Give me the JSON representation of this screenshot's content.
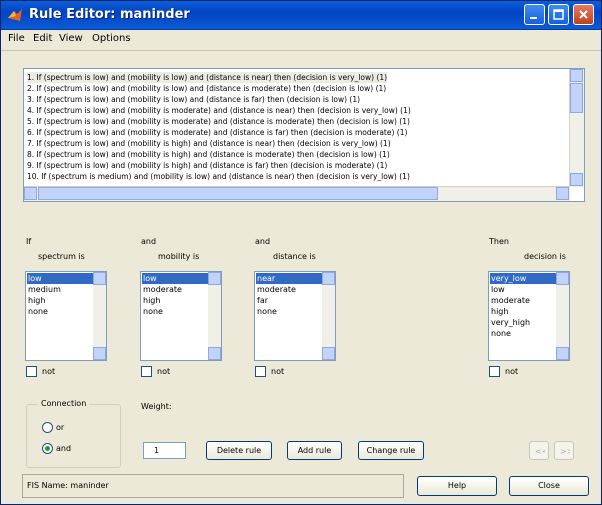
{
  "window": {
    "title": "Rule Editor: maninder"
  },
  "menu": [
    "File",
    "Edit",
    "View",
    "Options"
  ],
  "rules": [
    "1. If (spectrum is low) and (mobility is low) and (distance is near) then (decision is very_low) (1)",
    "2. If (spectrum is low) and (mobility is low) and (distance is moderate) then (decision is low) (1)",
    "3. If (spectrum is low) and (mobility is low) and (distance is far) then (decision is low) (1)",
    "4. If (spectrum is low) and (mobility is moderate) and (distance is near) then (decision is very_low) (1)",
    "5. If (spectrum is low) and (mobility is moderate) and (distance is moderate) then (decision is low) (1)",
    "6. If (spectrum is low) and (mobility is moderate) and (distance is far) then (decision is moderate) (1)",
    "7. If (spectrum is low) and (mobility is high) and (distance is near) then (decision is very_low) (1)",
    "8. If (spectrum is low) and (mobility is high) and (distance is moderate) then (decision is low) (1)",
    "9. If (spectrum is low) and (mobility is high) and (distance is far) then (decision is moderate) (1)",
    "10. If (spectrum is medium) and (mobility is low) and (distance is near) then (decision is very_low) (1)"
  ],
  "antecedents": [
    {
      "prefix": "If",
      "label": "spectrum is",
      "options": [
        "low",
        "medium",
        "high",
        "none"
      ],
      "not_label": "not"
    },
    {
      "prefix": "and",
      "label": "mobility is",
      "options": [
        "low",
        "moderate",
        "high",
        "none"
      ],
      "not_label": "not"
    },
    {
      "prefix": "and",
      "label": "distance is",
      "options": [
        "near",
        "moderate",
        "far",
        "none"
      ],
      "not_label": "not"
    }
  ],
  "consequent": {
    "prefix": "Then",
    "label": "decision is",
    "options": [
      "very_low",
      "low",
      "moderate",
      "high",
      "very_high",
      "none"
    ],
    "not_label": "not"
  },
  "connection": {
    "title": "Connection",
    "options": [
      "or",
      "and"
    ],
    "selected": "and"
  },
  "weight": {
    "label": "Weight:",
    "value": "1"
  },
  "buttons": {
    "delete": "Delete rule",
    "add": "Add rule",
    "change": "Change rule",
    "help": "Help",
    "close": "Close"
  },
  "status": {
    "fis_name": "FIS Name: maninder"
  },
  "colors": {
    "titlebar": "#0443c4",
    "selection": "#316ac5",
    "face": "#ece9d8"
  }
}
